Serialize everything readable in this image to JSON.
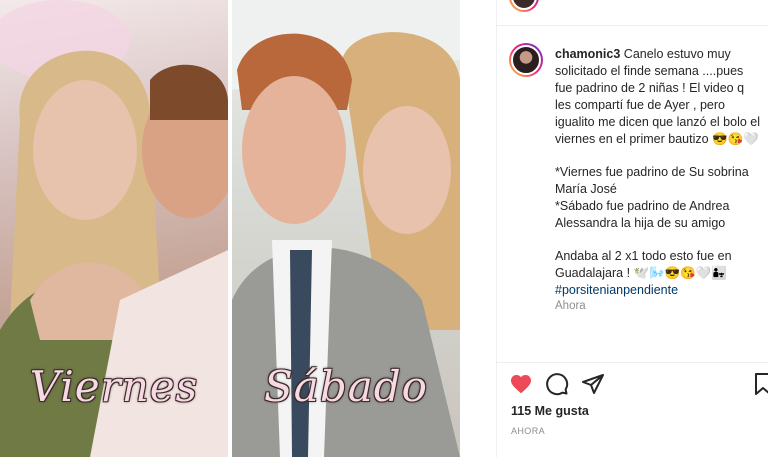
{
  "photo": {
    "left_label": "Viernes",
    "right_label": "Sábado"
  },
  "post": {
    "username": "chamonic3",
    "caption_lines": [
      "Canelo estuvo muy solicitado el finde semana ....pues fue padrino de 2 niñas ! El video q les compartí fue de Ayer , pero igualito me dicen que lanzó el bolo el viernes en el primer bautizo 😎😘🤍",
      "*Viernes fue padrino de Su sobrina María José\n*Sábado fue padrino de Andrea Alessandra la hija de su amigo",
      "Andaba al 2 x1 todo esto fue en Guadalajara ! 🕊️🌬️😎😘🤍👨‍👧"
    ],
    "hashtag": "#porsitenianpendiente",
    "relative_time": "Ahora",
    "likes": "115 Me gusta",
    "date": "AHORA"
  },
  "icons": {
    "like": "heart-filled-icon",
    "comment": "comment-icon",
    "share": "share-icon",
    "save": "bookmark-icon"
  },
  "colors": {
    "like_red": "#ed4956",
    "hashtag_blue": "#00376b",
    "muted": "#8e8e8e"
  }
}
